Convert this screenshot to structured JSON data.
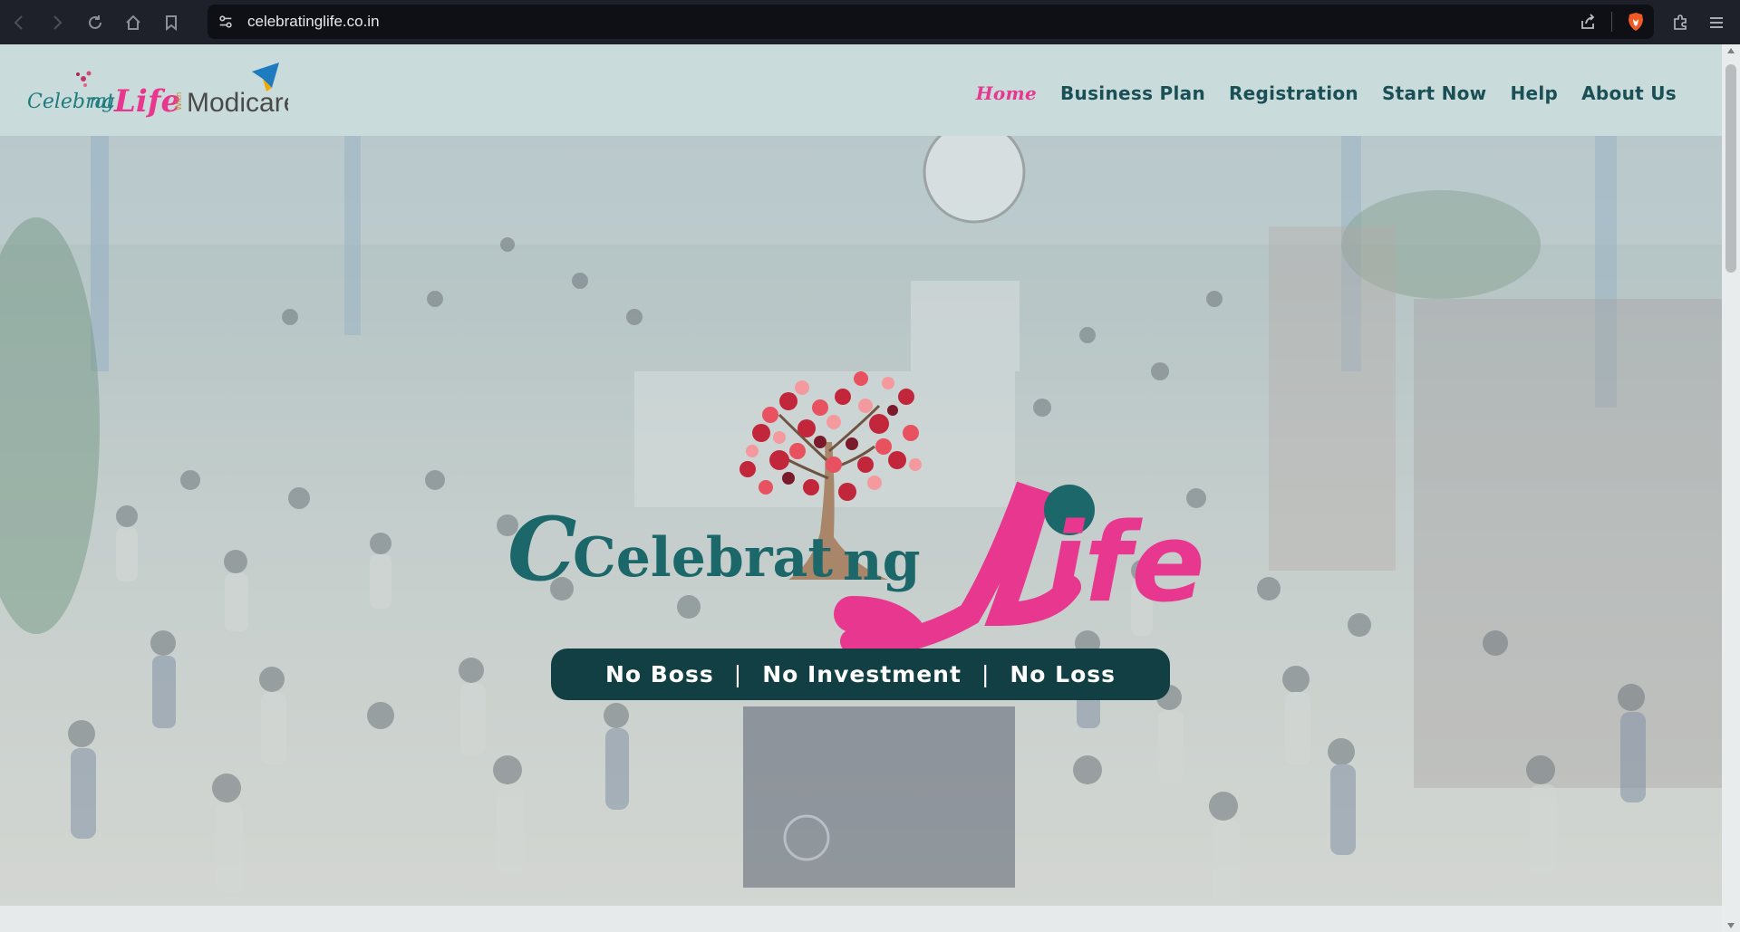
{
  "browser": {
    "url": "celebratinglife.co.in"
  },
  "site": {
    "logo_text": "CelebratingLife With Modicare",
    "nav": [
      {
        "label": "Home",
        "active": true
      },
      {
        "label": "Business Plan",
        "active": false
      },
      {
        "label": "Registration",
        "active": false
      },
      {
        "label": "Start Now",
        "active": false
      },
      {
        "label": "Help",
        "active": false
      },
      {
        "label": "About Us",
        "active": false
      }
    ]
  },
  "hero": {
    "logo_text_left": "Celebrat",
    "logo_text_mid": "ng",
    "logo_text_right": "ife",
    "tagline": {
      "part1": "No Boss",
      "sep": "|",
      "part2": "No Investment",
      "part3": "No Loss"
    }
  },
  "colors": {
    "brand_teal": "#1a4f55",
    "brand_pink": "#e8378f",
    "tagline_bg": "#123f43"
  }
}
